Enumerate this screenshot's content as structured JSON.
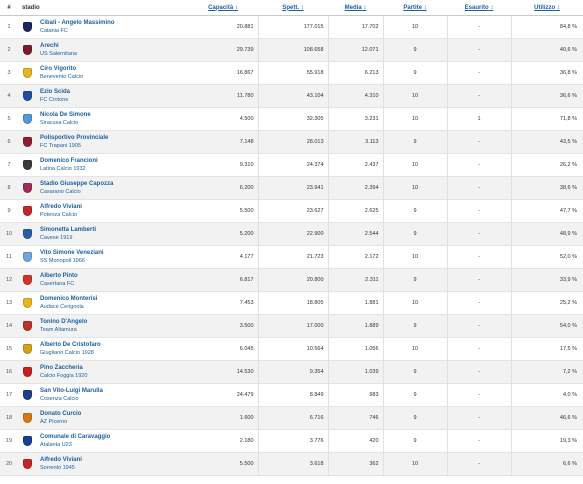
{
  "headers": {
    "rank": "#",
    "stadio": "stadio",
    "capacita": "Capacità",
    "spett": "Spett.",
    "media": "Media",
    "partite": "Partite",
    "esaurito": "Esaurito",
    "utilizzo": "Utilizzo"
  },
  "sort_glyph": "↕",
  "rows": [
    {
      "rank": "1",
      "stadium": "Cibali - Angelo Massimino",
      "club": "Catania FC",
      "capacita": "20.881",
      "spett": "177.015",
      "media": "17.702",
      "partite": "10",
      "esaurito": "-",
      "utilizzo": "84,8 %",
      "crest_color": "#1b2a5e"
    },
    {
      "rank": "2",
      "stadium": "Arechi",
      "club": "US Salernitana",
      "capacita": "29.739",
      "spett": "108.658",
      "media": "12.071",
      "partite": "9",
      "esaurito": "-",
      "utilizzo": "40,6 %",
      "crest_color": "#7a1a2c"
    },
    {
      "rank": "3",
      "stadium": "Ciro Vigorito",
      "club": "Benevento Calcio",
      "capacita": "16.867",
      "spett": "55.918",
      "media": "6.213",
      "partite": "9",
      "esaurito": "-",
      "utilizzo": "36,8 %",
      "crest_color": "#e8b420"
    },
    {
      "rank": "4",
      "stadium": "Ezio Scida",
      "club": "FC Crotone",
      "capacita": "11.780",
      "spett": "43.104",
      "media": "4.310",
      "partite": "10",
      "esaurito": "-",
      "utilizzo": "36,6 %",
      "crest_color": "#1f4fa0"
    },
    {
      "rank": "5",
      "stadium": "Nicola De Simone",
      "club": "Siracusa Calcio",
      "capacita": "4.500",
      "spett": "32.305",
      "media": "3.231",
      "partite": "10",
      "esaurito": "1",
      "utilizzo": "71,8 %",
      "crest_color": "#4e9bd6"
    },
    {
      "rank": "6",
      "stadium": "Polisportivo Provinciale",
      "club": "FC Trapani 1905",
      "capacita": "7.148",
      "spett": "28.013",
      "media": "3.113",
      "partite": "9",
      "esaurito": "-",
      "utilizzo": "43,5 %",
      "crest_color": "#8e1f2f"
    },
    {
      "rank": "7",
      "stadium": "Domenico Francioni",
      "club": "Latina Calcio 1932",
      "capacita": "9.310",
      "spett": "24.374",
      "media": "2.437",
      "partite": "10",
      "esaurito": "-",
      "utilizzo": "26,2 %",
      "crest_color": "#3b3b3b"
    },
    {
      "rank": "8",
      "stadium": "Stadio Giuseppe Capozza",
      "club": "Casarano Calcio",
      "capacita": "6.200",
      "spett": "23.941",
      "media": "2.394",
      "partite": "10",
      "esaurito": "-",
      "utilizzo": "38,6 %",
      "crest_color": "#9b2f5a"
    },
    {
      "rank": "9",
      "stadium": "Alfredo Viviani",
      "club": "Potenza Calcio",
      "capacita": "5.500",
      "spett": "23.627",
      "media": "2.625",
      "partite": "9",
      "esaurito": "-",
      "utilizzo": "47,7 %",
      "crest_color": "#c5262a"
    },
    {
      "rank": "10",
      "stadium": "Simonetta Lamberti",
      "club": "Cavese 1919",
      "capacita": "5.200",
      "spett": "22.900",
      "media": "2.544",
      "partite": "9",
      "esaurito": "-",
      "utilizzo": "48,9 %",
      "crest_color": "#2a5fa8"
    },
    {
      "rank": "11",
      "stadium": "Vito Simone Veneziani",
      "club": "SS Monopoli 1966",
      "capacita": "4.177",
      "spett": "21.723",
      "media": "2.172",
      "partite": "10",
      "esaurito": "-",
      "utilizzo": "52,0 %",
      "crest_color": "#6fa8dc"
    },
    {
      "rank": "12",
      "stadium": "Alberto Pinto",
      "club": "Casertana FC",
      "capacita": "6.817",
      "spett": "20.800",
      "media": "2.311",
      "partite": "9",
      "esaurito": "-",
      "utilizzo": "33,9 %",
      "crest_color": "#d0342c"
    },
    {
      "rank": "13",
      "stadium": "Domenico Monterisi",
      "club": "Audace Cerignola",
      "capacita": "7.453",
      "spett": "18.805",
      "media": "1.881",
      "partite": "10",
      "esaurito": "-",
      "utilizzo": "25,2 %",
      "crest_color": "#e8b420"
    },
    {
      "rank": "14",
      "stadium": "Tonino D'Angelo",
      "club": "Team Altamura",
      "capacita": "3.500",
      "spett": "17.000",
      "media": "1.889",
      "partite": "9",
      "esaurito": "-",
      "utilizzo": "54,0 %",
      "crest_color": "#b8322e"
    },
    {
      "rank": "15",
      "stadium": "Alberto De Cristofaro",
      "club": "Giugliano Calcio 1928",
      "capacita": "6.045",
      "spett": "10.564",
      "media": "1.056",
      "partite": "10",
      "esaurito": "-",
      "utilizzo": "17,5 %",
      "crest_color": "#d4a017"
    },
    {
      "rank": "16",
      "stadium": "Pino Zaccheria",
      "club": "Calcio Foggia 1920",
      "capacita": "14.530",
      "spett": "9.354",
      "media": "1.039",
      "partite": "9",
      "esaurito": "-",
      "utilizzo": "7,2 %",
      "crest_color": "#c8201e"
    },
    {
      "rank": "17",
      "stadium": "San Vito-Luigi Marulla",
      "club": "Cosenza Calcio",
      "capacita": "24.479",
      "spett": "8.849",
      "media": "983",
      "partite": "9",
      "esaurito": "-",
      "utilizzo": "4,0 %",
      "crest_color": "#1f3f8a"
    },
    {
      "rank": "18",
      "stadium": "Donato Curcio",
      "club": "AZ Picerno",
      "capacita": "1.600",
      "spett": "6.716",
      "media": "746",
      "partite": "9",
      "esaurito": "-",
      "utilizzo": "46,6 %",
      "crest_color": "#d27a16"
    },
    {
      "rank": "19",
      "stadium": "Comunale di Caravaggio",
      "club": "Atalanta U23",
      "capacita": "2.180",
      "spett": "3.776",
      "media": "420",
      "partite": "9",
      "esaurito": "-",
      "utilizzo": "19,3 %",
      "crest_color": "#1c3f94"
    },
    {
      "rank": "20",
      "stadium": "Alfredo Viviani",
      "club": "Sorrento 1945",
      "capacita": "5.500",
      "spett": "3.618",
      "media": "362",
      "partite": "10",
      "esaurito": "-",
      "utilizzo": "6,6 %",
      "crest_color": "#c5262a"
    }
  ]
}
